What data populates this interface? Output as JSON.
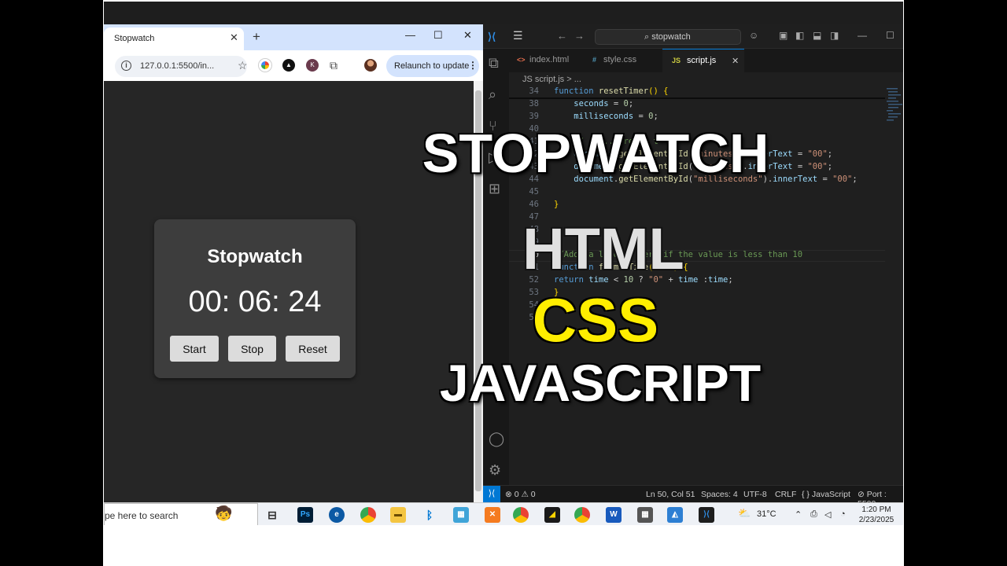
{
  "browser": {
    "tab_title": "Stopwatch",
    "tab_close": "✕",
    "new_tab": "+",
    "window_controls": {
      "minimize": "—",
      "maximize": "☐",
      "close": "✕"
    },
    "url": "127.0.0.1:5500/in...",
    "relaunch_label": "Relaunch to update",
    "menu_dots": "⋮"
  },
  "stopwatch": {
    "title": "Stopwatch",
    "time": "00: 06: 24",
    "buttons": {
      "start": "Start",
      "stop": "Stop",
      "reset": "Reset"
    }
  },
  "vscode": {
    "search": "stopwatch",
    "tabs": [
      {
        "icon": "<>",
        "label": "index.html",
        "icon_color": "#e06c4c"
      },
      {
        "icon": "#",
        "label": "style.css",
        "icon_color": "#519aba"
      },
      {
        "icon": "JS",
        "label": "script.js",
        "icon_color": "#cbcb41",
        "close": "✕"
      }
    ],
    "breadcrumb": "JS script.js  >  ...",
    "lines": {
      "n34": "34",
      "n38": "38",
      "n39": "39",
      "n40": "40",
      "n41": "41",
      "n42": "42",
      "n43": "43",
      "n44": "44",
      "n45": "45",
      "n46": "46",
      "n47": "47",
      "n48": "48",
      "n49": "49",
      "n50": "50",
      "n51": "51",
      "n52": "52",
      "n53": "53",
      "n54": "54",
      "n55": "55"
    },
    "status": {
      "problems": "⊗ 0 ⚠ 0",
      "cursor": "Ln 50, Col 51",
      "spaces": "Spaces: 4",
      "encoding": "UTF-8",
      "eol": "CRLF",
      "language": "{ } JavaScript",
      "port": "⊘ Port : 5500"
    }
  },
  "overlay": {
    "line1": "STOPWATCH",
    "line2": "HTML",
    "line3": "CSS",
    "line4": "JAVASCRIPT",
    "colors": {
      "title": "#ffffff",
      "html": "#e0e0e0",
      "css": "#ffee00",
      "js": "#ffffff"
    }
  },
  "taskbar": {
    "search_text": "pe here to search",
    "weather": "31°C",
    "time": "1:20 PM",
    "date": "2/23/2025"
  }
}
